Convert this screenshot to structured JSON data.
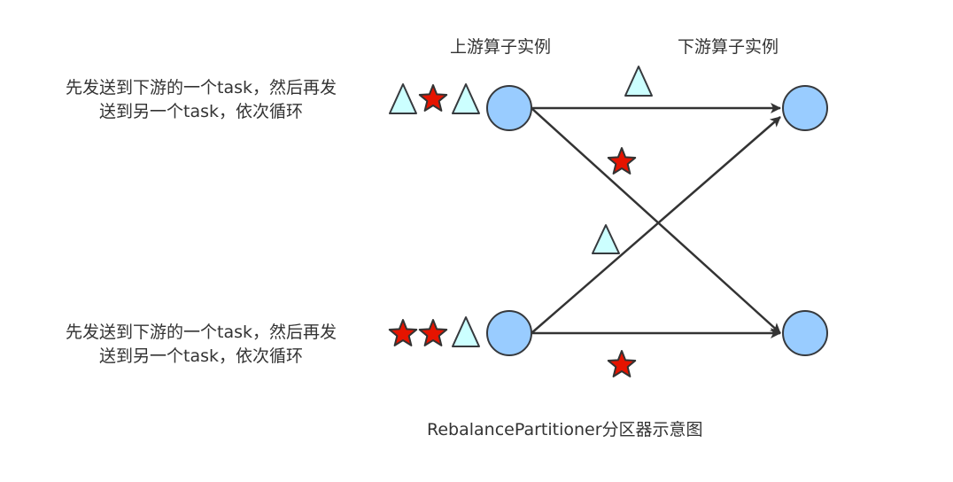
{
  "headers": {
    "upstream": "上游算子实例",
    "downstream": "下游算子实例"
  },
  "descriptions": {
    "top": {
      "line1": "先发送到下游的一个task，然后再发",
      "line2": "送到另一个task，依次循环"
    },
    "bottom": {
      "line1": "先发送到下游的一个task，然后再发",
      "line2": "送到另一个task，依次循环"
    }
  },
  "caption": "RebalancePartitioner分区器示意图",
  "colors": {
    "node_fill": "#99ccff",
    "node_stroke": "#36393d",
    "star_fill": "#e51400",
    "star_stroke": "#333333",
    "triangle_fill": "#ccffff",
    "triangle_stroke": "#36393d",
    "edge": "#333333"
  },
  "queues": {
    "top": [
      "triangle",
      "star",
      "triangle"
    ],
    "bottom": [
      "star",
      "star",
      "triangle"
    ]
  },
  "edge_markers": [
    "triangle",
    "star",
    "triangle",
    "star"
  ]
}
